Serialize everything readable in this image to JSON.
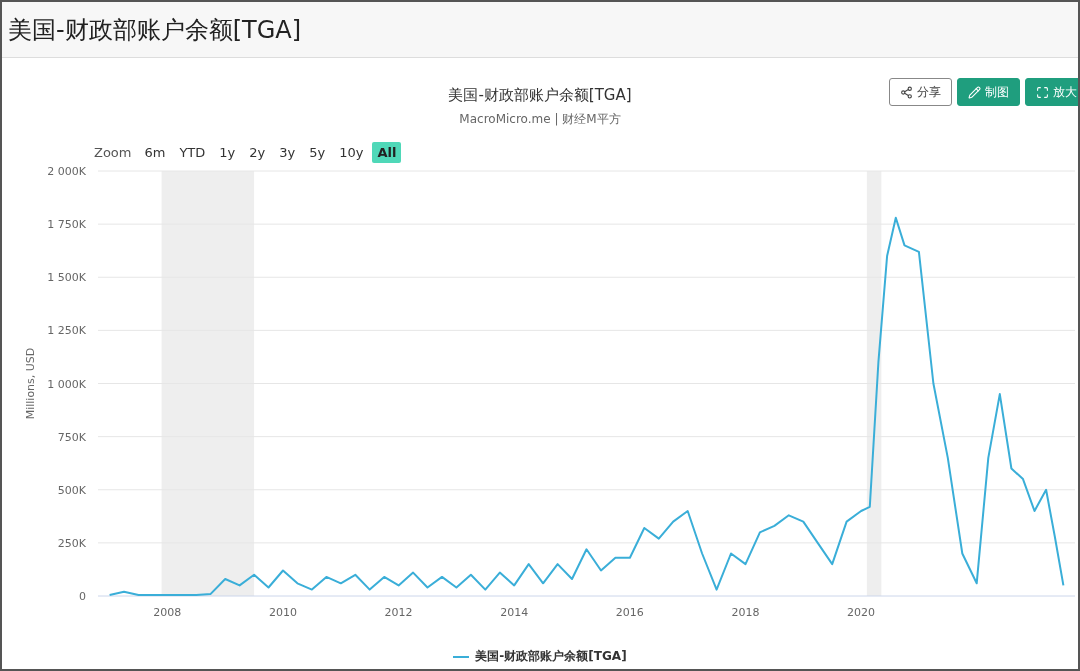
{
  "page": {
    "title": "美国-财政部账户余额[TGA]"
  },
  "chart_card": {
    "subtitle": "MacroMicro.me | 财经M平方",
    "actions": [
      {
        "kind": "outline",
        "label": "分享"
      },
      {
        "kind": "solid",
        "label": "制图"
      },
      {
        "kind": "solid",
        "label": "放大"
      }
    ],
    "zoom": {
      "label": "Zoom",
      "ranges": [
        {
          "label": "6m",
          "selected": false
        },
        {
          "label": "YTD",
          "selected": false
        },
        {
          "label": "1y",
          "selected": false
        },
        {
          "label": "2y",
          "selected": false
        },
        {
          "label": "3y",
          "selected": false
        },
        {
          "label": "5y",
          "selected": false
        },
        {
          "label": "10y",
          "selected": false
        },
        {
          "label": "All",
          "selected": true
        }
      ]
    },
    "chart_data": {
      "type": "line",
      "title": "美国-财政部账户余额[TGA]",
      "ylabel": "Millions, USD",
      "xlim": [
        2006.8,
        2023.7
      ],
      "ylim": [
        0,
        2000000
      ],
      "xticks": [
        2008,
        2010,
        2012,
        2014,
        2016,
        2018,
        2020
      ],
      "yticks": [
        {
          "value": 0,
          "label": "0"
        },
        {
          "value": 250000,
          "label": "250K"
        },
        {
          "value": 500000,
          "label": "500K"
        },
        {
          "value": 750000,
          "label": "750K"
        },
        {
          "value": 1000000,
          "label": "1 000K"
        },
        {
          "value": 1250000,
          "label": "1 250K"
        },
        {
          "value": 1500000,
          "label": "1 500K"
        },
        {
          "value": 1750000,
          "label": "1 750K"
        },
        {
          "value": 2000000,
          "label": "2 000K"
        }
      ],
      "x": [
        2007,
        2007.25,
        2007.5,
        2007.75,
        2008,
        2008.25,
        2008.5,
        2008.75,
        2009,
        2009.25,
        2009.5,
        2009.75,
        2010,
        2010.25,
        2010.5,
        2010.75,
        2011,
        2011.25,
        2011.5,
        2011.75,
        2012,
        2012.25,
        2012.5,
        2012.75,
        2013,
        2013.25,
        2013.5,
        2013.75,
        2014,
        2014.25,
        2014.5,
        2014.75,
        2015,
        2015.25,
        2015.5,
        2015.75,
        2016,
        2016.25,
        2016.5,
        2016.75,
        2017,
        2017.25,
        2017.5,
        2017.75,
        2018,
        2018.25,
        2018.5,
        2018.75,
        2019,
        2019.25,
        2019.5,
        2019.75,
        2020,
        2020.15,
        2020.3,
        2020.45,
        2020.6,
        2020.75,
        2021,
        2021.25,
        2021.5,
        2021.75,
        2022,
        2022.2,
        2022.4,
        2022.6,
        2022.8,
        2023,
        2023.2,
        2023.35,
        2023.5
      ],
      "series": [
        {
          "name": "美国-财政部账户余额[TGA]",
          "color": "#3aaed8",
          "values": [
            5000,
            20000,
            5000,
            5000,
            5000,
            5000,
            5000,
            10000,
            80000,
            50000,
            100000,
            40000,
            120000,
            60000,
            30000,
            90000,
            60000,
            100000,
            30000,
            90000,
            50000,
            110000,
            40000,
            90000,
            40000,
            100000,
            30000,
            110000,
            50000,
            150000,
            60000,
            150000,
            80000,
            220000,
            120000,
            180000,
            180000,
            320000,
            270000,
            350000,
            400000,
            200000,
            30000,
            200000,
            150000,
            300000,
            330000,
            380000,
            350000,
            250000,
            150000,
            350000,
            400000,
            420000,
            1100000,
            1600000,
            1780000,
            1650000,
            1620000,
            1000000,
            650000,
            200000,
            60000,
            650000,
            950000,
            600000,
            550000,
            400000,
            500000,
            280000,
            50000
          ]
        }
      ],
      "grid": true,
      "bands": [
        {
          "axis": "x",
          "from": 2007.9,
          "to": 2009.5
        },
        {
          "axis": "x",
          "from": 2020.1,
          "to": 2020.35
        }
      ]
    }
  }
}
